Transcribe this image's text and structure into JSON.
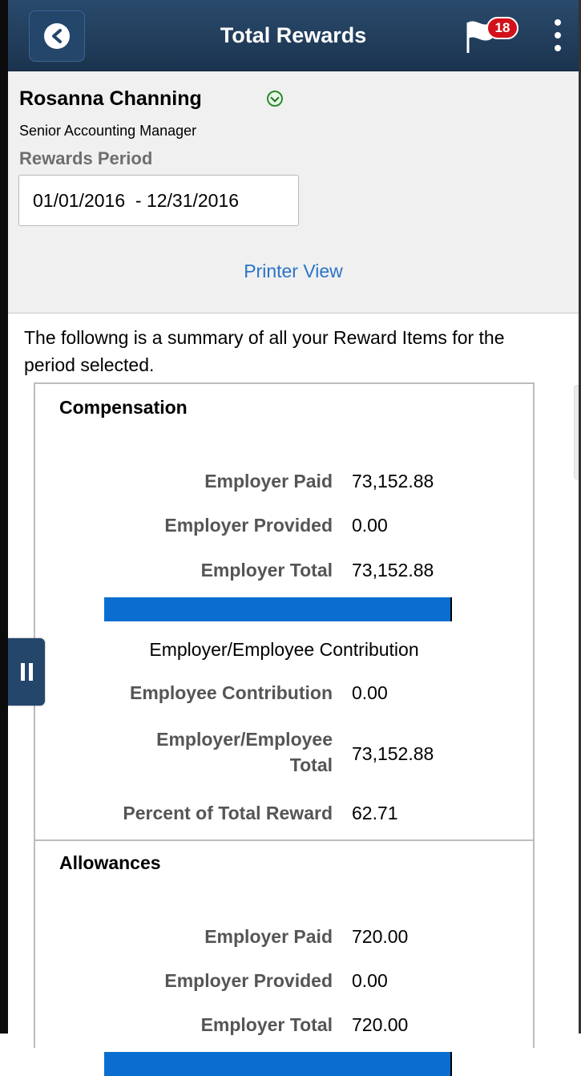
{
  "header": {
    "title": "Total Rewards",
    "notification_count": "18",
    "back_icon": "chevron-left-icon",
    "flag_icon": "flag-icon",
    "more_icon": "vertical-dots-icon"
  },
  "employee": {
    "name": "Rosanna Channing",
    "job_title": "Senior Accounting Manager"
  },
  "rewards_period": {
    "label": "Rewards Period",
    "value": "01/01/2016  - 12/31/2016"
  },
  "printer_view_label": "Printer View",
  "intro_text": "The followng is a summary of all your Reward Items for the period selected.",
  "colors": {
    "header_bg": "#1f3b5a",
    "link": "#2a74c6",
    "bar": "#0a6ed1",
    "badge": "#d2111a"
  },
  "compensation": {
    "title": "Compensation",
    "employer_paid_label": "Employer Paid",
    "employer_paid": "73,152.88",
    "employer_provided_label": "Employer Provided",
    "employer_provided": "0.00",
    "employer_total_label": "Employer Total",
    "employer_total": "73,152.88",
    "bar_fraction": 1.0,
    "contribution_title": "Employer/Employee Contribution",
    "employee_contribution_label": "Employee Contribution",
    "employee_contribution": "0.00",
    "combined_total_label_line1": "Employer/Employee",
    "combined_total_label_line2": "Total",
    "combined_total": "73,152.88",
    "percent_label": "Percent of Total Reward",
    "percent": "62.71"
  },
  "allowances": {
    "title": "Allowances",
    "employer_paid_label": "Employer Paid",
    "employer_paid": "720.00",
    "employer_provided_label": "Employer Provided",
    "employer_provided": "0.00",
    "employer_total_label": "Employer Total",
    "employer_total": "720.00",
    "bar_fraction": 1.0
  }
}
